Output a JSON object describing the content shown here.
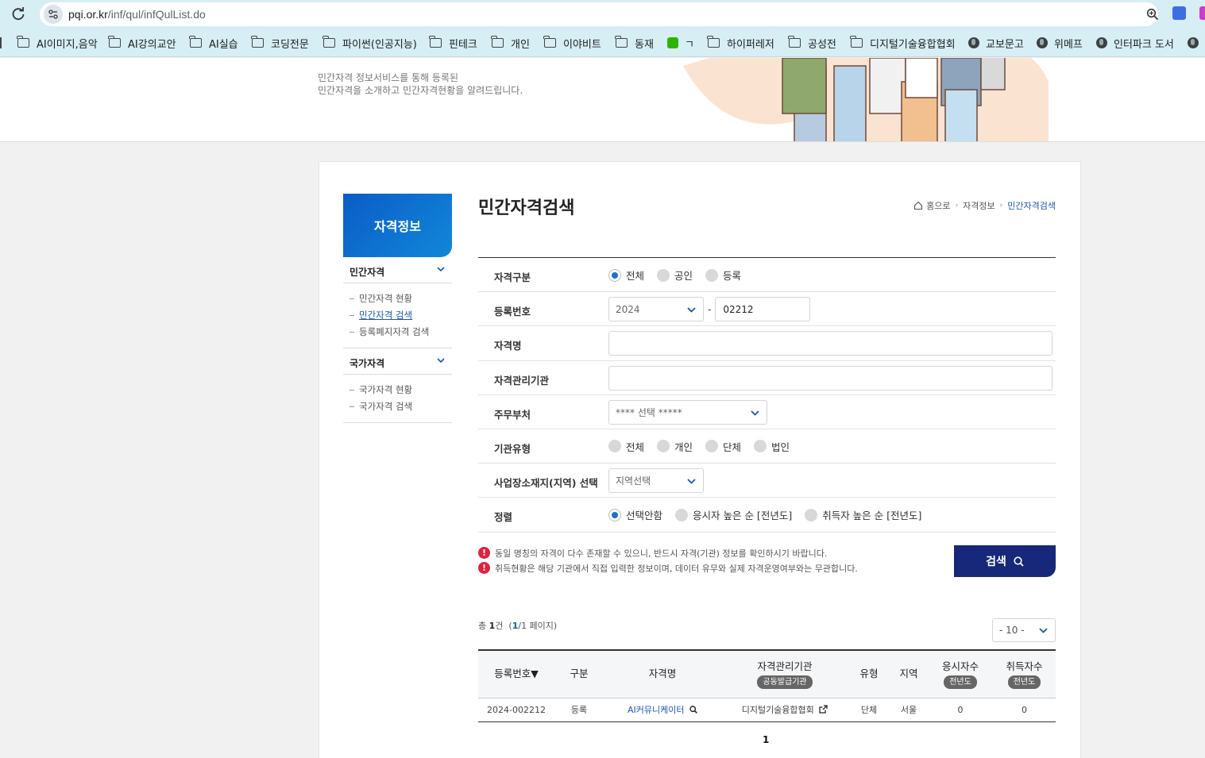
{
  "browser": {
    "url_host": "pqi.or.kr",
    "url_path": "/inf/qul/infQulList.do",
    "bookmarks": [
      {
        "label": "AI이미지,음악",
        "icon": "folder-icon"
      },
      {
        "label": "AI강의교안",
        "icon": "folder-icon"
      },
      {
        "label": "AI실습",
        "icon": "folder-icon"
      },
      {
        "label": "코딩전문",
        "icon": "folder-icon"
      },
      {
        "label": "파이썬(인공지능)",
        "icon": "folder-icon"
      },
      {
        "label": "핀테크",
        "icon": "folder-icon"
      },
      {
        "label": "개인",
        "icon": "folder-icon"
      },
      {
        "label": "이야비트",
        "icon": "folder-icon"
      },
      {
        "label": "동재",
        "icon": "folder-icon"
      },
      {
        "label": "ㄱ",
        "icon": "naver-icon"
      },
      {
        "label": "하이퍼레저",
        "icon": "folder-icon"
      },
      {
        "label": "공성전",
        "icon": "folder-icon"
      },
      {
        "label": "디지털기술융합협회",
        "icon": "folder-icon"
      },
      {
        "label": "교보문고",
        "icon": "globe-icon"
      },
      {
        "label": "위메프",
        "icon": "globe-icon"
      },
      {
        "label": "인터파크 도서",
        "icon": "globe-icon"
      }
    ]
  },
  "banner": {
    "desc_line1": "민간자격 정보서비스를 통해 등록된",
    "desc_line2": "민간자격을 소개하고 민간자격현황을 알려드립니다."
  },
  "lnb": {
    "title": "자격정보",
    "section1": "민간자격",
    "section1_items": [
      "민간자격 현황",
      "민간자격 검색",
      "등록폐지자격 검색"
    ],
    "section2": "국가자격",
    "section2_items": [
      "국가자격 현황",
      "국가자격 검색"
    ]
  },
  "page": {
    "title": "민간자격검색",
    "breadcrumb": [
      "홈으로",
      "자격정보",
      "민간자격검색"
    ]
  },
  "form": {
    "type_label": "자격구분",
    "type_options": [
      "전체",
      "공인",
      "등록"
    ],
    "regno_label": "등록번호",
    "regno_year": "2024",
    "regno_number": "02212",
    "name_label": "자격명",
    "name_value": "",
    "org_label": "자격관리기관",
    "org_value": "",
    "ministry_label": "주무부처",
    "ministry_value": "**** 선택 *****",
    "orgtype_label": "기관유형",
    "orgtype_options": [
      "전체",
      "개인",
      "단체",
      "법인"
    ],
    "region_label": "사업장소재지(지역) 선택",
    "region_value": "지역선택",
    "sort_label": "정렬",
    "sort_options": [
      "선택안함",
      "응시자 높은 순 [전년도]",
      "취득자 높은 순 [전년도]"
    ],
    "notice1": "동일 명칭의 자격이 다수 존재할 수 있으니, 반드시 자격(기관) 정보를 확인하시기 바랍니다.",
    "notice2": "취득현황은 해당 기관에서 직접 입력한 정보이며, 데이터 유무와 실제 자격운영여부와는 무관합니다.",
    "search_label": "검색"
  },
  "results": {
    "total_prefix": "총",
    "total_count": "1",
    "total_suffix": "건",
    "page_cur": "1",
    "page_total": "/1 페이지)",
    "page_open": "(",
    "per_page": "- 10 -",
    "headers": {
      "regno": "등록번호▼",
      "type": "구분",
      "name": "자격명",
      "org": "자격관리기관",
      "org_tag": "공동발급기관",
      "orgtype": "유형",
      "region": "지역",
      "applicants": "응시자수",
      "applicants_tag": "전년도",
      "acquirers": "취득자수",
      "acquirers_tag": "전년도"
    },
    "rows": [
      {
        "regno": "2024-002212",
        "type": "등록",
        "name": "AI커뮤니케이터",
        "org": "디지털기술융합협회",
        "orgtype": "단체",
        "region": "서울",
        "applicants": "0",
        "acquirers": "0"
      }
    ],
    "pagination": "1"
  }
}
